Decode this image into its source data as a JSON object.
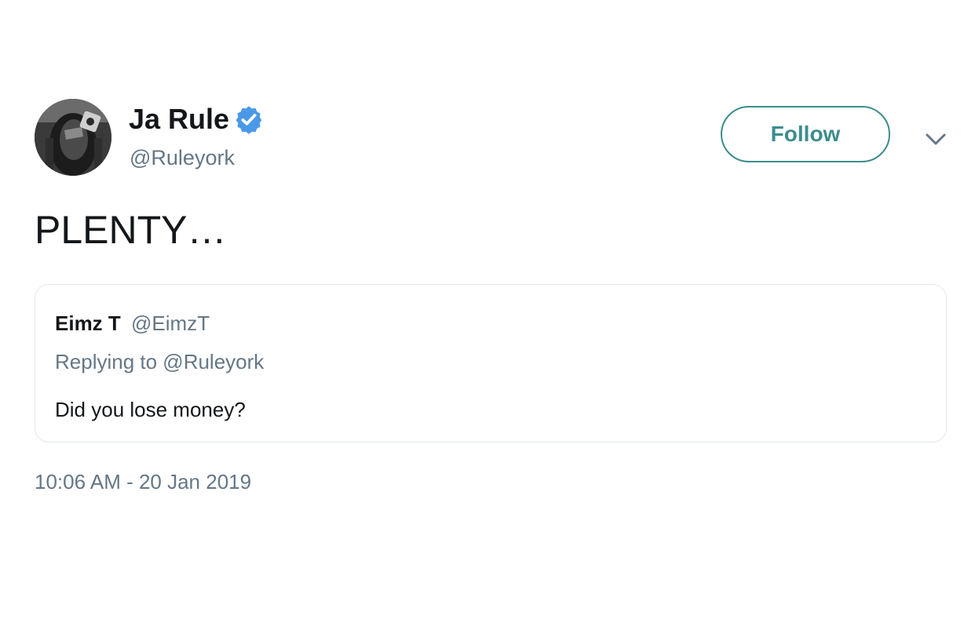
{
  "author": {
    "display_name": "Ja Rule",
    "handle": "@Ruleyork",
    "verified": true,
    "avatar_icon": "profile-photo",
    "verified_icon": "verified-badge-icon"
  },
  "actions": {
    "follow_label": "Follow",
    "more_icon": "chevron-down-icon"
  },
  "tweet": {
    "text": "PLENTY…",
    "timestamp": "10:06 AM - 20 Jan 2019"
  },
  "quoted_tweet": {
    "display_name": "Eimz T",
    "handle": "@EimzT",
    "replying_to": "Replying to @Ruleyork",
    "text": "Did you lose money?"
  },
  "colors": {
    "accent": "#3d8c8c",
    "verified_blue": "#1da1f2",
    "secondary_text": "#657786",
    "primary_text": "#14171a",
    "border": "#e1e8ed"
  }
}
